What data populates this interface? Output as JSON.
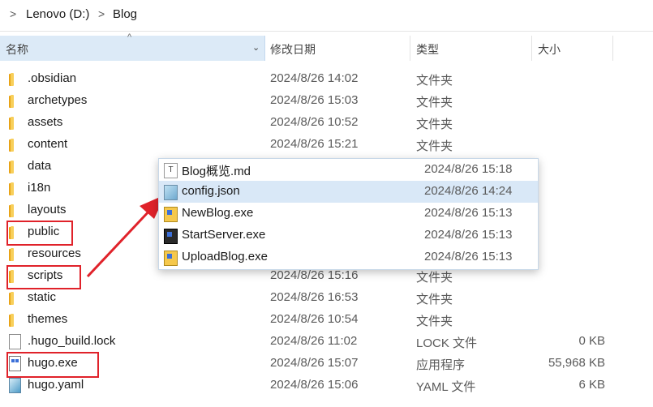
{
  "breadcrumb": {
    "drive": "Lenovo (D:)",
    "folder": "Blog",
    "sep": ">"
  },
  "columns": {
    "name": "名称",
    "date": "修改日期",
    "type": "类型",
    "size": "大小"
  },
  "rows": [
    {
      "name": ".obsidian",
      "date": "2024/8/26 14:02",
      "type": "文件夹",
      "size": "",
      "icon": "folder-icon"
    },
    {
      "name": "archetypes",
      "date": "2024/8/26 15:03",
      "type": "文件夹",
      "size": "",
      "icon": "folder-icon"
    },
    {
      "name": "assets",
      "date": "2024/8/26 10:52",
      "type": "文件夹",
      "size": "",
      "icon": "folder-icon"
    },
    {
      "name": "content",
      "date": "2024/8/26 15:21",
      "type": "文件夹",
      "size": "",
      "icon": "folder-icon"
    },
    {
      "name": "data",
      "date": "",
      "type": "",
      "size": "",
      "icon": "folder-icon"
    },
    {
      "name": "i18n",
      "date": "",
      "type": "",
      "size": "",
      "icon": "folder-icon"
    },
    {
      "name": "layouts",
      "date": "",
      "type": "",
      "size": "",
      "icon": "folder-icon"
    },
    {
      "name": "public",
      "date": "",
      "type": "",
      "size": "",
      "icon": "folder-icon"
    },
    {
      "name": "resources",
      "date": "",
      "type": "",
      "size": "",
      "icon": "folder-icon"
    },
    {
      "name": "scripts",
      "date": "2024/8/26 15:16",
      "type": "文件夹",
      "size": "",
      "icon": "folder-icon"
    },
    {
      "name": "static",
      "date": "2024/8/26 16:53",
      "type": "文件夹",
      "size": "",
      "icon": "folder-icon"
    },
    {
      "name": "themes",
      "date": "2024/8/26 10:54",
      "type": "文件夹",
      "size": "",
      "icon": "folder-icon"
    },
    {
      "name": ".hugo_build.lock",
      "date": "2024/8/26 11:02",
      "type": "LOCK 文件",
      "size": "0 KB",
      "icon": "file-icon"
    },
    {
      "name": "hugo.exe",
      "date": "2024/8/26 15:07",
      "type": "应用程序",
      "size": "55,968 KB",
      "icon": "exe-icon"
    },
    {
      "name": "hugo.yaml",
      "date": "2024/8/26 15:06",
      "type": "YAML 文件",
      "size": "6 KB",
      "icon": "yaml-icon"
    }
  ],
  "popup": [
    {
      "name": "Blog概览.md",
      "date": "2024/8/26 15:18",
      "icon": "text-file-icon"
    },
    {
      "name": "config.json",
      "date": "2024/8/26 14:24",
      "icon": "json-file-icon"
    },
    {
      "name": "NewBlog.exe",
      "date": "2024/8/26 15:13",
      "icon": "exe-icon"
    },
    {
      "name": "StartServer.exe",
      "date": "2024/8/26 15:13",
      "icon": "exe-icon"
    },
    {
      "name": "UploadBlog.exe",
      "date": "2024/8/26 15:13",
      "icon": "exe-icon"
    }
  ],
  "colors": {
    "highlight": "#e0222a",
    "selection": "#d9e8f7",
    "header_active": "#dceaf7"
  }
}
